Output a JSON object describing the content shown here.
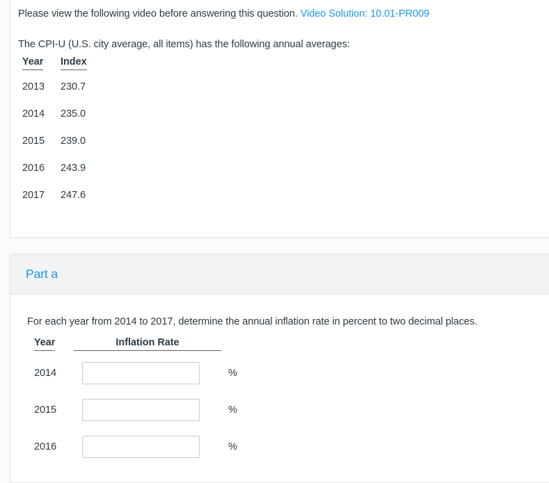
{
  "question_card": {
    "intro": {
      "text": "Please view the following video before answering this question.",
      "link_label": "Video Solution: 10.01-PR009"
    },
    "prompt": "The CPI-U (U.S. city average, all items) has the following annual averages:",
    "table": {
      "headers": [
        "Year",
        "Index"
      ],
      "rows": [
        {
          "year": "2013",
          "index": "230.7"
        },
        {
          "year": "2014",
          "index": "235.0"
        },
        {
          "year": "2015",
          "index": "239.0"
        },
        {
          "year": "2016",
          "index": "243.9"
        },
        {
          "year": "2017",
          "index": "247.6"
        }
      ]
    }
  },
  "part_card": {
    "title": "Part a",
    "instruction": "For each year from 2014 to 2017, determine the annual inflation rate in percent to two decimal places.",
    "table": {
      "headers": [
        "Year",
        "Inflation Rate"
      ],
      "rows": [
        {
          "year": "2014",
          "value": "",
          "placeholder": "",
          "unit": "%"
        },
        {
          "year": "2015",
          "value": "",
          "placeholder": "",
          "unit": "%"
        },
        {
          "year": "2016",
          "value": "",
          "placeholder": "",
          "unit": "%"
        }
      ]
    }
  },
  "colors": {
    "link_blue": "#1a9ae8",
    "text_dark": "#2d3b45",
    "header_band": "#f2f3f4",
    "card_border": "#e3e5e7",
    "input_border": "#c7cdd1",
    "page_background": "#fbfbfb"
  }
}
